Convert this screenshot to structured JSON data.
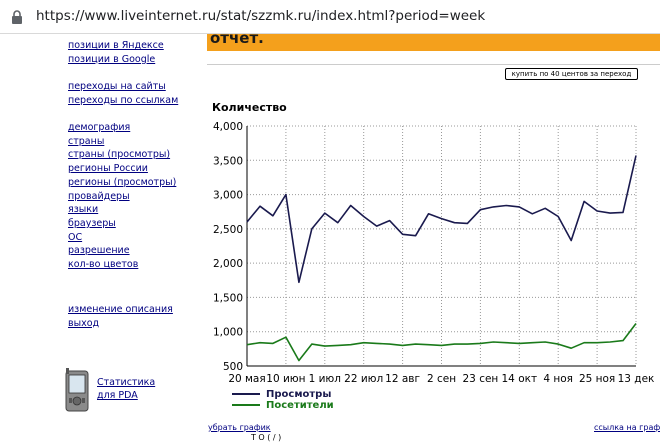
{
  "browser": {
    "url": "https://www.liveinternet.ru/stat/szzmk.ru/index.html?period=week"
  },
  "banner": {
    "text": "отчет."
  },
  "buy_button": "купить по 40 центов за переход",
  "sidebar": {
    "groups": [
      [
        "позиции в Яндексе",
        "позиции в Google"
      ],
      [
        "переходы на сайты",
        "переходы по ссылкам"
      ],
      [
        "демография",
        "страны",
        "страны (просмотры)",
        "регионы России",
        "регионы (просмотры)",
        "провайдеры",
        "языки",
        "браузеры",
        "ОС",
        "разрешение",
        "кол-во цветов"
      ],
      [
        "изменение описания",
        "выход"
      ]
    ]
  },
  "pda": {
    "line1": "Статистика",
    "line2": "для PDA"
  },
  "footer": {
    "left_link": "убрать график",
    "right_link": "ссылка на график",
    "partial_text": "Т        О  (  / )"
  },
  "chart_data": {
    "type": "line",
    "title": "Количество",
    "ylim": [
      500,
      4000
    ],
    "yticks": [
      "4,000",
      "3,500",
      "3,000",
      "2,500",
      "2,000",
      "1,500",
      "1,000",
      "500"
    ],
    "yticks_values": [
      4000,
      3500,
      3000,
      2500,
      2000,
      1500,
      1000,
      500
    ],
    "xtick_labels": [
      "20 мая",
      "10 июн",
      "1 июл",
      "22 июл",
      "12 авг",
      "2 сен",
      "23 сен",
      "14 окт",
      "4 ноя",
      "25 ноя",
      "13 дек"
    ],
    "grid": true,
    "legend_position": "bottom-left",
    "series": [
      {
        "name": "Просмотры",
        "color": "#1a1a4e",
        "values": [
          2600,
          2830,
          2690,
          3000,
          1720,
          2500,
          2730,
          2590,
          2840,
          2680,
          2540,
          2620,
          2420,
          2400,
          2720,
          2650,
          2590,
          2580,
          2780,
          2820,
          2840,
          2820,
          2720,
          2800,
          2680,
          2330,
          2900,
          2760,
          2730,
          2740,
          3570
        ]
      },
      {
        "name": "Посетители",
        "color": "#1a7a1a",
        "values": [
          810,
          840,
          830,
          920,
          580,
          820,
          790,
          800,
          810,
          840,
          830,
          820,
          800,
          820,
          810,
          800,
          820,
          820,
          830,
          850,
          840,
          830,
          840,
          850,
          820,
          760,
          840,
          840,
          850,
          870,
          1120
        ]
      }
    ]
  }
}
